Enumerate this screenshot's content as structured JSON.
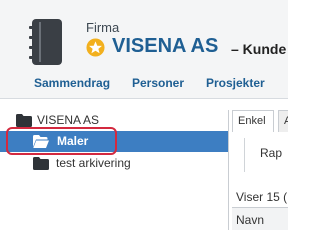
{
  "header": {
    "company_type": "Firma",
    "company_name": "VISENA AS",
    "company_suffix": "– Kunde (",
    "icon": "notebook-icon",
    "favorite_icon": "star-icon"
  },
  "nav": {
    "items": [
      {
        "label": "Sammendrag"
      },
      {
        "label": "Personer"
      },
      {
        "label": "Prosjekter"
      }
    ]
  },
  "tree": {
    "root": {
      "label": "VISENA AS",
      "icon": "folder-icon"
    },
    "items": [
      {
        "label": "Maler",
        "selected": true,
        "icon": "folder-open-icon"
      },
      {
        "label": "test arkivering",
        "selected": false,
        "icon": "folder-icon"
      }
    ]
  },
  "panel": {
    "tabs": [
      {
        "label": "Enkel",
        "active": true
      },
      {
        "label": "A",
        "active": false
      }
    ],
    "toolbar": {
      "rapport_label": "Rap"
    },
    "viser_text": "Viser 15 (",
    "columns": [
      {
        "label": "Navn"
      }
    ]
  },
  "colors": {
    "accent": "#1f5f93",
    "selection": "#3d7ec2",
    "highlight_outline": "#d3293f",
    "star": "#f2b01e"
  }
}
